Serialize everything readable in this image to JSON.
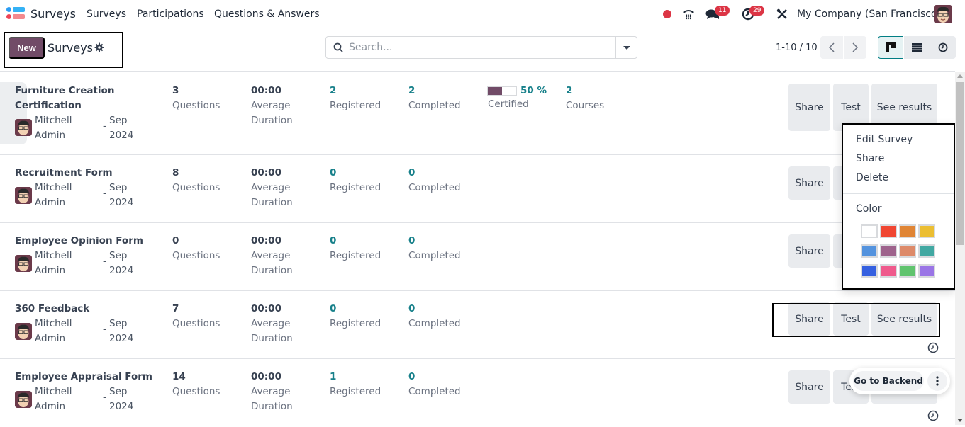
{
  "navbar": {
    "app_name": "Surveys",
    "menus": [
      "Surveys",
      "Participations",
      "Questions & Answers"
    ],
    "messages_badge": "11",
    "activities_badge": "29",
    "company": "My Company (San Francisco)"
  },
  "control_panel": {
    "new_label": "New",
    "title": "Surveys",
    "search_placeholder": "Search...",
    "pager": "1-10 / 10",
    "views": [
      "kanban",
      "list",
      "activity"
    ],
    "active_view": "kanban"
  },
  "labels": {
    "questions": "Questions",
    "average": "Average",
    "duration": "Duration",
    "registered": "Registered",
    "completed": "Completed",
    "certified": "Certified",
    "courses": "Courses",
    "share": "Share",
    "test": "Test",
    "see_results": "See results"
  },
  "surveys": [
    {
      "title_line1": "Furniture Creation",
      "title_line2": "Certification",
      "owner_first": "Mitchell",
      "owner_last": "Admin",
      "month": "Sep",
      "year": "2024",
      "questions": "3",
      "duration": "00:00",
      "registered": "2",
      "completed": "2",
      "certified_pct": "50 %",
      "certified_fraction": 0.5,
      "courses": "2"
    },
    {
      "title_line1": "Recruitment Form",
      "owner_first": "Mitchell",
      "owner_last": "Admin",
      "month": "Sep",
      "year": "2024",
      "questions": "8",
      "duration": "00:00",
      "registered": "0",
      "completed": "0"
    },
    {
      "title_line1": "Employee Opinion Form",
      "owner_first": "Mitchell",
      "owner_last": "Admin",
      "month": "Sep",
      "year": "2024",
      "questions": "0",
      "duration": "00:00",
      "registered": "0",
      "completed": "0"
    },
    {
      "title_line1": "360 Feedback",
      "owner_first": "Mitchell",
      "owner_last": "Admin",
      "month": "Sep",
      "year": "2024",
      "questions": "7",
      "duration": "00:00",
      "registered": "0",
      "completed": "0"
    },
    {
      "title_line1": "Employee Appraisal Form",
      "owner_first": "Mitchell",
      "owner_last": "Admin",
      "month": "Sep",
      "year": "2024",
      "questions": "14",
      "duration": "00:00",
      "registered": "1",
      "completed": "0"
    }
  ],
  "dropdown": {
    "items": [
      "Edit Survey",
      "Share",
      "Delete"
    ],
    "color_label": "Color",
    "colors": [
      "#ffffff",
      "#f04632",
      "#e08535",
      "#ebbe32",
      "#5493de",
      "#9e638c",
      "#dd8a69",
      "#41a8a2",
      "#3560e0",
      "#ef5a8c",
      "#60c46e",
      "#9a75e6"
    ]
  },
  "backend": {
    "go_label": "Go to Backend"
  }
}
